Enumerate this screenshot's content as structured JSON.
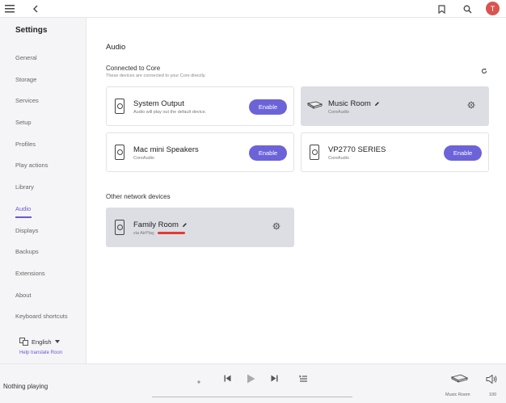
{
  "topbar": {
    "menu_icon": "hamburger-icon",
    "back_icon": "chevron-left-icon",
    "bookmark_icon": "bookmark-icon",
    "search_icon": "search-icon",
    "avatar_initial": "T",
    "avatar_color": "#d9534f"
  },
  "sidebar": {
    "title": "Settings",
    "items": [
      "General",
      "Storage",
      "Services",
      "Setup",
      "Profiles",
      "Play actions",
      "Library",
      "Audio",
      "Displays",
      "Backups",
      "Extensions",
      "About",
      "Keyboard shortcuts"
    ],
    "active_item": "Audio",
    "language": "English",
    "help_link": "Help translate Roon"
  },
  "main": {
    "title": "Audio",
    "connected_heading": "Connected to Core",
    "connected_sub": "These devices are connected to your Core directly.",
    "other_heading": "Other network devices",
    "devices": [
      {
        "name": "System Output",
        "desc": "Audio will play out the default device.",
        "action": "Enable"
      },
      {
        "name": "Music Room",
        "desc": "CoreAudio"
      },
      {
        "name": "Mac mini Speakers",
        "desc": "CoreAudio",
        "action": "Enable"
      },
      {
        "name": "VP2770 SERIES",
        "desc": "CoreAudio",
        "action": "Enable"
      }
    ],
    "network_devices": [
      {
        "name": "Family Room",
        "desc": "via AirPlay,"
      }
    ]
  },
  "footer": {
    "now_playing": "Nothing playing",
    "zone_name": "Music Room",
    "volume": "100"
  },
  "colors": {
    "accent": "#6c63d9",
    "card_gray": "#dcdee3",
    "redaction": "#e23b2e"
  }
}
